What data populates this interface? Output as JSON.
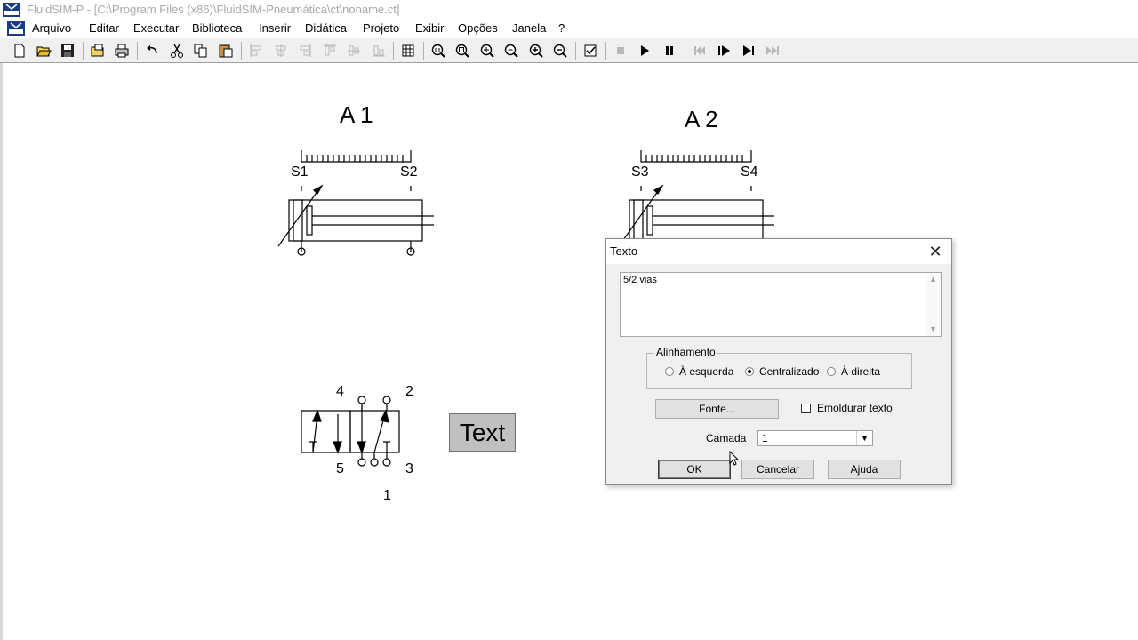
{
  "window": {
    "title": "FluidSIM-P - [C:\\Program Files (x86)\\FluidSIM-Pneumática\\ct\\noname.ct]"
  },
  "menu": [
    "Arquivo",
    "Editar",
    "Executar",
    "Biblioteca",
    "Inserir",
    "Didática",
    "Projeto",
    "Exibir",
    "Opções",
    "Janela",
    "?"
  ],
  "toolbar": {
    "icons": [
      "new-icon",
      "open-icon",
      "save-icon",
      "open-folder-icon",
      "print-icon",
      "undo-icon",
      "cut-icon",
      "copy-icon",
      "paste-icon",
      "align-left-icon",
      "align-center-icon",
      "align-right-icon",
      "align-top-icon",
      "align-middle-icon",
      "align-bottom-icon",
      "grid-icon",
      "zoom-1-1-icon",
      "zoom-window-icon",
      "zoom-fit-icon",
      "zoom-prev-icon",
      "zoom-in-icon",
      "zoom-out-icon",
      "check-icon",
      "stop-icon",
      "play-icon",
      "pause-icon",
      "reset-icon",
      "step-icon",
      "step-end-icon",
      "fast-forward-icon"
    ]
  },
  "canvas": {
    "cylinder1": {
      "label": "A 1",
      "sensor_left": "S1",
      "sensor_right": "S2"
    },
    "cylinder2": {
      "label": "A 2",
      "sensor_left": "S3",
      "sensor_right": "S4"
    },
    "valve": {
      "port_4": "4",
      "port_2": "2",
      "port_5": "5",
      "port_3": "3",
      "port_1": "1"
    },
    "text_element": "Text"
  },
  "dialog": {
    "title": "Texto",
    "text_value": "5/2 vias",
    "alignment": {
      "label": "Alinhamento",
      "options": [
        "À esquerda",
        "Centralizado",
        "À direita"
      ],
      "selected": "Centralizado"
    },
    "font_button": "Fonte...",
    "frame_checkbox": "Emoldurar texto",
    "frame_checked": false,
    "layer_label": "Camada",
    "layer_value": "1",
    "ok_button": "OK",
    "cancel_button": "Cancelar",
    "help_button": "Ajuda"
  }
}
